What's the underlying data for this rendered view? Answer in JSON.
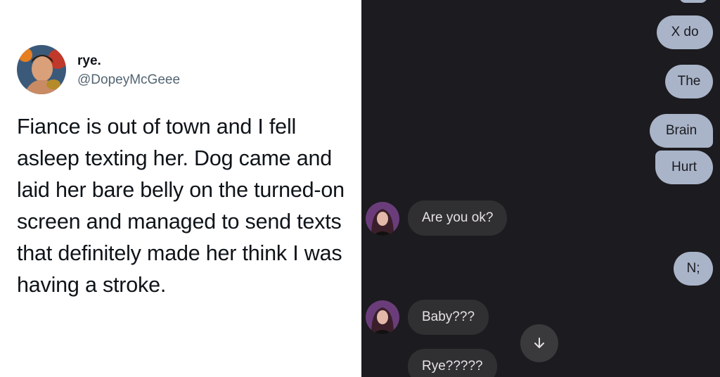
{
  "tweet": {
    "display_name": "rye.",
    "handle": "@DopeyMcGeee",
    "text": "Fiance is out of town and I fell asleep texting her. Dog came and laid her bare belly on the turned-on screen and managed to send texts that definitely made her think I was having a stroke."
  },
  "chat": {
    "sent_messages": [
      "X do",
      "The",
      "Brain",
      "Hurt",
      "N;"
    ],
    "received_messages": [
      "Are you ok?",
      "Baby???",
      "Rye?????"
    ]
  },
  "icons": {
    "scroll_down": "arrow-down-icon"
  },
  "colors": {
    "chat_background": "#1c1b1f",
    "sent_bubble": "#a9b4c9",
    "received_bubble": "#303033"
  }
}
